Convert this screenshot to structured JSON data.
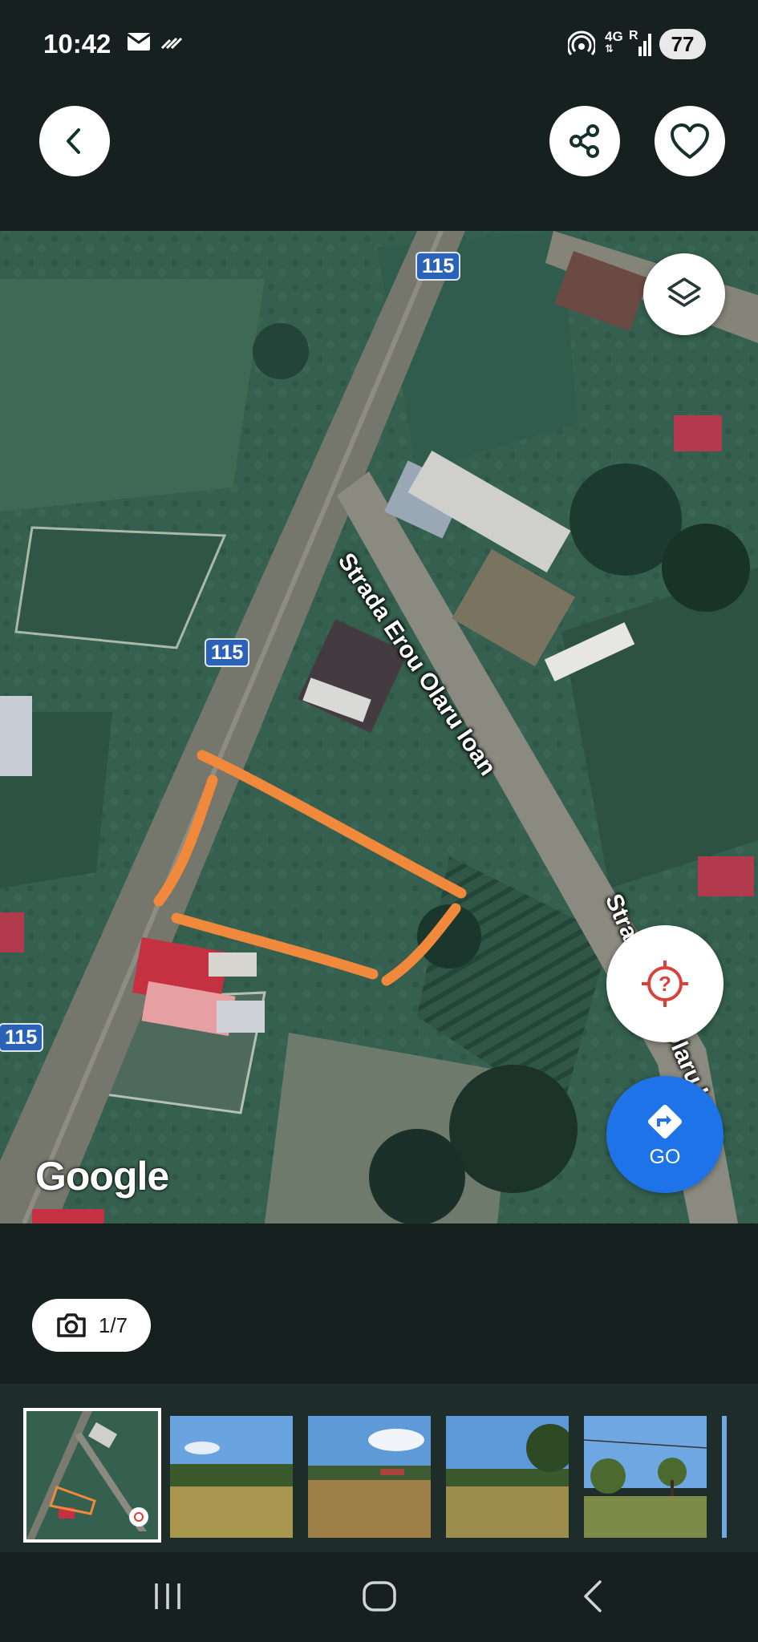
{
  "status_bar": {
    "time": "10:42",
    "network_top": "4G",
    "network_bottom": "R",
    "battery": "77",
    "icons": [
      "mail-icon",
      "wifi-calling-icon",
      "hotspot-icon",
      "signal-icon"
    ]
  },
  "top_bar": {
    "back_icon": "chevron-left-icon",
    "share_icon": "share-icon",
    "favorite_icon": "heart-icon"
  },
  "map": {
    "road_labels": [
      "115",
      "115",
      "115"
    ],
    "street_label_1": "Strada Erou Olaru Ioan",
    "street_label_2": "Strada Erou Olaru Ioan",
    "logo": "Google",
    "layers_icon": "layers-icon",
    "locate_icon": "locate-question-icon",
    "go_label": "GO",
    "go_icon": "directions-icon",
    "outline_color": "#f0893b"
  },
  "gallery": {
    "counter": "1/7",
    "camera_icon": "camera-icon"
  },
  "nav": {
    "recents_icon": "recents-icon",
    "home_icon": "home-icon",
    "back_icon": "back-icon"
  },
  "colors": {
    "background": "#16211f",
    "accent_blue": "#1e73e8",
    "locate_red": "#d9413a"
  }
}
